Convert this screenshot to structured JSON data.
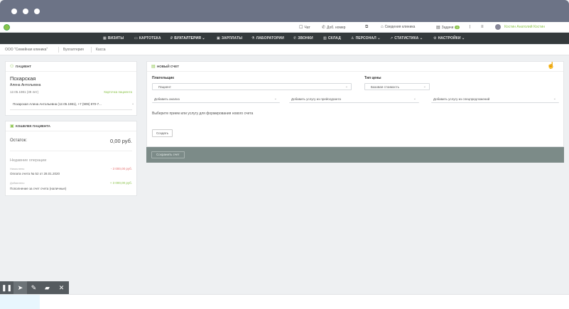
{
  "topbar": {
    "chat": "Чат",
    "add_number": "Доб. номер",
    "client_info": "Сведения клиника",
    "tasks": "Задачи",
    "tasks_count": "0",
    "user": "Костин Анатолий Костин"
  },
  "nav": {
    "items": [
      {
        "label": "ВИЗИТЫ",
        "icon": "calendar-icon"
      },
      {
        "label": "КАРТОТЕКА",
        "icon": "card-icon"
      },
      {
        "label": "БУХГАЛТЕРИЯ",
        "icon": "ruble-icon"
      },
      {
        "label": "ЗАРПЛАТЫ",
        "icon": "wallet-icon"
      },
      {
        "label": "ЛАБОРАТОРИИ",
        "icon": "flask-icon"
      },
      {
        "label": "ЗВОНКИ",
        "icon": "phone-icon"
      },
      {
        "label": "СКЛАД",
        "icon": "box-icon"
      },
      {
        "label": "ПЕРСОНАЛ",
        "icon": "person-icon"
      },
      {
        "label": "СТАТИСТИКА",
        "icon": "chart-icon"
      },
      {
        "label": "НАСТРОЙКИ",
        "icon": "gear-icon"
      }
    ]
  },
  "breadcrumb": {
    "org": "ООО \"Семейная клиника\"",
    "section": "Бухгалтерия",
    "page": "Касса"
  },
  "patient": {
    "header": "ПАЦИЕНТ",
    "surname": "Пскарская",
    "name": "Алена Антольевна",
    "birth": "12.05.1981 (39 лет)",
    "card_link": "Карточка пациента",
    "selector": "Пскарская Алена Антольевна (12.05.1981), +7 (909) 870-7..."
  },
  "wallet": {
    "header": "КОШЕЛЕК ПАЦИЕНТА",
    "balance_label": "Остаток:",
    "balance_value": "0,00 руб.",
    "history_title": "Недавние операции",
    "ops": [
      {
        "type": "Начислено",
        "desc": "Оплата счета № 52 от 28.01.2020",
        "amount": "- 3 000,00 руб."
      },
      {
        "type": "Добавлено",
        "desc": "Пополнение за счет счета (наличные)",
        "amount": "+ 3 000,00 руб."
      }
    ]
  },
  "invoice": {
    "header": "НОВЫЙ СЧЕТ",
    "payer_label": "Плательщик",
    "payer_value": "Пациент",
    "price_type_label": "Тип цены",
    "price_type_value": "Базовая стоимость",
    "add_analysis": "Добавить анализ",
    "add_service_price": "Добавить услугу из прейскуранта",
    "add_service_schedule": "Добавить услугу из спецпредложений",
    "hint": "Выберите прием или услугу для формирования нового счета",
    "save_button": "Создать",
    "bottom_button": "Сохранить счет"
  },
  "toolbar": {
    "tools": [
      "pause-icon",
      "cursor-icon",
      "pen-icon",
      "highlighter-icon",
      "close-icon"
    ]
  }
}
